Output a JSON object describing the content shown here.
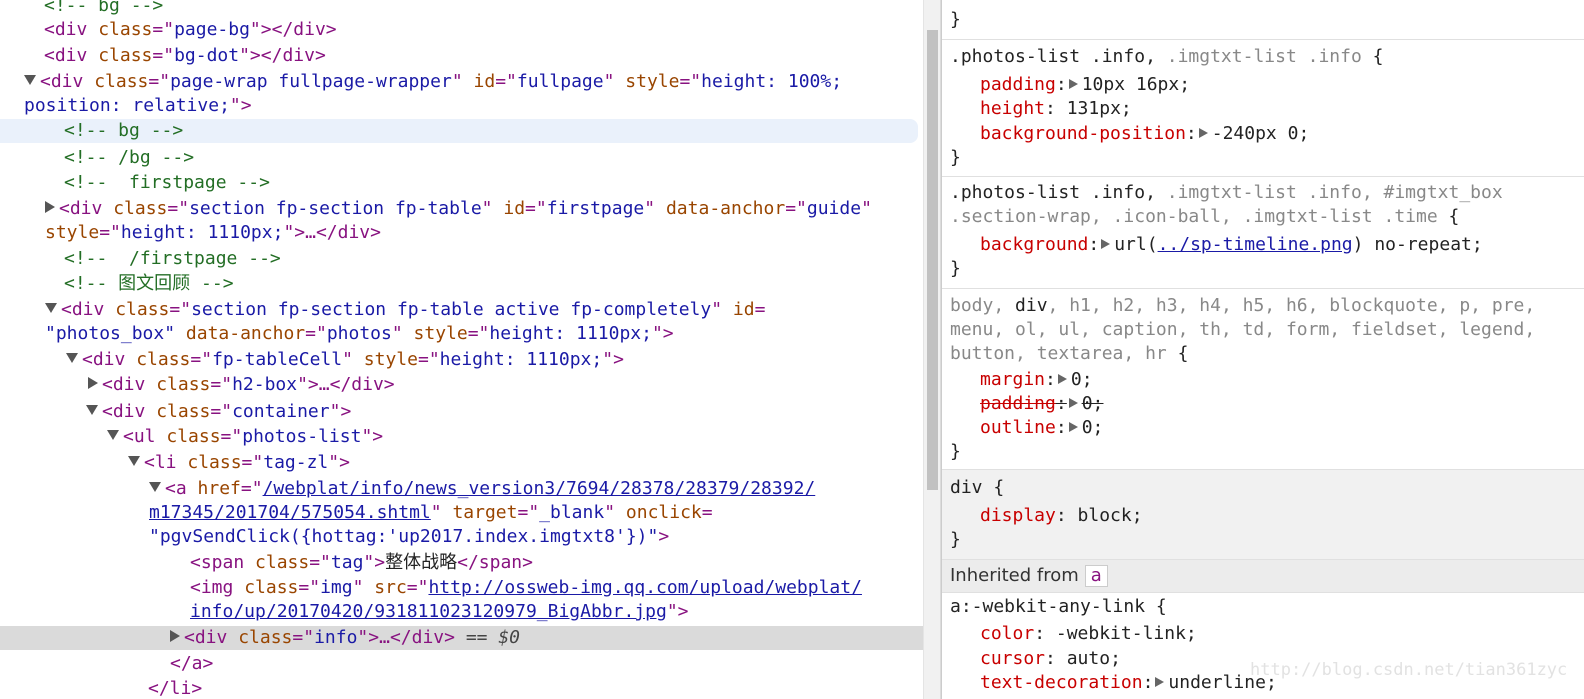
{
  "elements": {
    "lines": [
      {
        "comment": "<!-- bg -->"
      },
      {
        "open": "div",
        "attrs": [
          [
            "class",
            "page-bg"
          ]
        ],
        "close": "</div>"
      },
      {
        "open": "div",
        "attrs": [
          [
            "class",
            "bg-dot"
          ]
        ],
        "close": "</div>"
      },
      {
        "open": "div",
        "attrs": [
          [
            "class",
            "page-wrap fullpage-wrapper"
          ],
          [
            "id",
            "fullpage"
          ],
          [
            "style",
            "height: 100%;"
          ]
        ]
      },
      {
        "cont": "position: relative;"
      },
      {
        "comment": "<!-- bg -->"
      },
      {
        "comment": "<!-- /bg -->"
      },
      {
        "comment": "<!--  firstpage -->"
      },
      {
        "open": "div",
        "attrs": [
          [
            "class",
            "section fp-section fp-table"
          ],
          [
            "id",
            "firstpage"
          ],
          [
            "data-anchor",
            "guide"
          ]
        ]
      },
      {
        "attrs2": [
          [
            "style",
            "height: 1110px;"
          ]
        ],
        "tail": "…</div>"
      },
      {
        "comment": "<!--  /firstpage -->"
      },
      {
        "comment": "<!-- 图文回顾 -->"
      },
      {
        "open": "div",
        "attrs": [
          [
            "class",
            "section fp-section fp-table active fp-completely"
          ],
          [
            "id",
            ""
          ]
        ]
      },
      {
        "cont_val": "photos_box",
        "attrs": [
          [
            "data-anchor",
            "photos"
          ],
          [
            "style",
            "height: 1110px;"
          ]
        ]
      },
      {
        "open": "div",
        "attrs": [
          [
            "class",
            "fp-tableCell"
          ],
          [
            "style",
            "height: 1110px;"
          ]
        ]
      },
      {
        "open": "div",
        "attrs": [
          [
            "class",
            "h2-box"
          ]
        ],
        "tail": "…</div>"
      },
      {
        "open": "div",
        "attrs": [
          [
            "class",
            "container"
          ]
        ]
      },
      {
        "open": "ul",
        "attrs": [
          [
            "class",
            "photos-list"
          ]
        ]
      },
      {
        "open": "li",
        "attrs": [
          [
            "class",
            "tag-zl"
          ]
        ]
      },
      {
        "open": "a",
        "href1": "/webplat/info/news_version3/7694/28378/28379/28392/"
      },
      {
        "href2": "m17345/201704/575054.shtml",
        "attrs": [
          [
            "target",
            "_blank"
          ],
          [
            "onclick",
            ""
          ]
        ]
      },
      {
        "onclick_val": "pgvSendClick({hottag:'up2017.index.imgtxt8'})"
      },
      {
        "open": "span",
        "attrs": [
          [
            "class",
            "tag"
          ]
        ],
        "text": "整体战略",
        "close": "</span>"
      },
      {
        "open": "img",
        "attrs": [
          [
            "class",
            "img"
          ]
        ],
        "src1": "http://ossweb-img.qq.com/upload/webplat/"
      },
      {
        "src2": "info/up/20170420/931811023120979_BigAbbr.jpg"
      },
      {
        "open": "div",
        "attrs": [
          [
            "class",
            "info"
          ]
        ],
        "tail": "…</div>",
        "marker": "== $0"
      },
      {
        "closing": "</a>"
      },
      {
        "closing": "</li>"
      }
    ]
  },
  "styles": {
    "top_close": "}",
    "rule1": {
      "selector_main": ".photos-list .info,",
      "selector_dim": ".imgtxt-list .info",
      "brace": "{",
      "props": [
        {
          "name": "padding",
          "value": "10px 16px;"
        },
        {
          "name": "height",
          "value": "131px;"
        },
        {
          "name": "background-position",
          "value": "-240px 0;"
        }
      ]
    },
    "rule2": {
      "line1_main": ".photos-list .info,",
      "line1_dim": ".imgtxt-list .info, #imgtxt_box",
      "line2_dim": ".section-wrap, .icon-ball, .imgtxt-list .time",
      "brace": "{",
      "prop": "background",
      "val_pre": "url(",
      "val_link": "../sp-timeline.png",
      "val_post": ") no-repeat;"
    },
    "rule3": {
      "line1": "body, div, h1, h2, h3, h4, h5, h6, blockquote, p, pre,",
      "line2": "menu, ol, ul, caption, th, td, form, fieldset, legend,",
      "line3": "button, textarea, hr {",
      "props": [
        {
          "name": "margin",
          "value": "0;",
          "struck": false
        },
        {
          "name": "padding",
          "value": "0;",
          "struck": true
        },
        {
          "name": "outline",
          "value": "0;",
          "struck": false
        }
      ]
    },
    "rule4": {
      "selector": "div {",
      "prop": "display",
      "value": "block;"
    },
    "inherited": {
      "label": "Inherited from",
      "tag": "a"
    },
    "rule5": {
      "selector": "a:-webkit-any-link {",
      "props": [
        {
          "name": "color",
          "value": "-webkit-link;"
        },
        {
          "name": "cursor",
          "value": "auto;"
        },
        {
          "name": "text-decoration",
          "value": "underline;"
        }
      ]
    }
  },
  "watermark": "http://blog.csdn.net/tian361zyc"
}
